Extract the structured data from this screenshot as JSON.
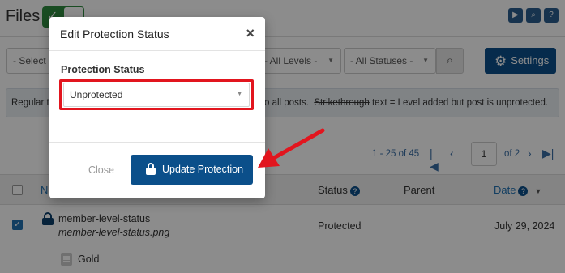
{
  "page": {
    "title": "Files",
    "filters": {
      "select_a": "- Select a",
      "levels": "- All Levels -",
      "statuses": "- All Statuses -"
    },
    "settings_label": "Settings",
    "info": {
      "left": "Regular t",
      "right_prefix": "o all posts.",
      "strike_word": "Strikethrough",
      "right_suffix": "text = Level added but post is unprotected."
    },
    "pagination": {
      "range": "1 - 25 of 45",
      "current_page": "1",
      "of_pages": "of 2"
    },
    "table": {
      "col_name": "N",
      "col_status": "Status",
      "col_parent": "Parent",
      "col_date": "Date",
      "rows": [
        {
          "name": "member-level-status",
          "file": "member-level-status.png",
          "status": "Protected",
          "date": "July 29, 2024",
          "level": "Gold"
        }
      ]
    }
  },
  "modal": {
    "title": "Edit Protection Status",
    "field_label": "Protection Status",
    "selected_value": "Unprotected",
    "close_label": "Close",
    "update_label": "Update Protection"
  },
  "colors": {
    "primary": "#0b4f8a",
    "highlight": "#e2151e",
    "toggle": "#2e8b3e"
  },
  "icons": [
    "close-icon",
    "lock-icon",
    "gear-icon",
    "search-icon",
    "help-icon",
    "chevron-left-icon",
    "chevron-right-icon",
    "document-icon",
    "arrow-annotation"
  ]
}
